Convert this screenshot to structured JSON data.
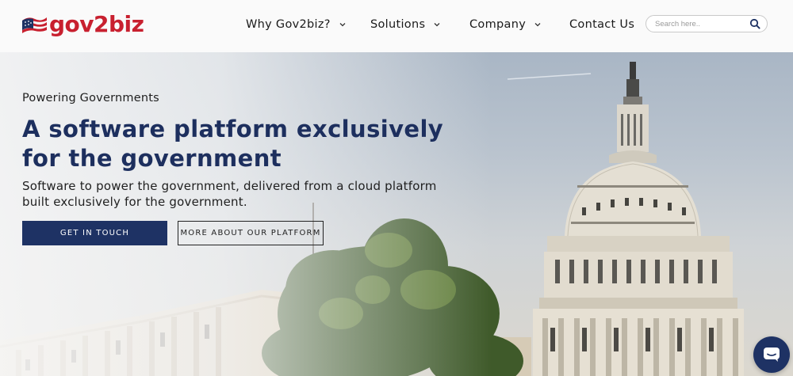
{
  "brand": {
    "name": "gov2biz",
    "logo_icon": "flag-icon"
  },
  "nav": {
    "items": [
      {
        "label": "Why Gov2biz?",
        "has_dropdown": true
      },
      {
        "label": "Solutions",
        "has_dropdown": true
      },
      {
        "label": "Company",
        "has_dropdown": true
      },
      {
        "label": "Contact Us",
        "has_dropdown": false
      }
    ]
  },
  "search": {
    "placeholder": "Search here..",
    "value": "",
    "icon": "search-icon"
  },
  "hero": {
    "eyebrow": "Powering Governments",
    "headline": "A software platform exclusively for the government",
    "subtext": "Software to power the government, delivered from a cloud platform built exclusively for the government.",
    "primary_button": "GET IN TOUCH",
    "secondary_button": "MORE ABOUT OUR PLATFORM"
  },
  "chat": {
    "icon": "chat-icon"
  },
  "colors": {
    "brand_red": "#c8202f",
    "brand_navy": "#1e3264",
    "headline": "#1d2f5e"
  }
}
